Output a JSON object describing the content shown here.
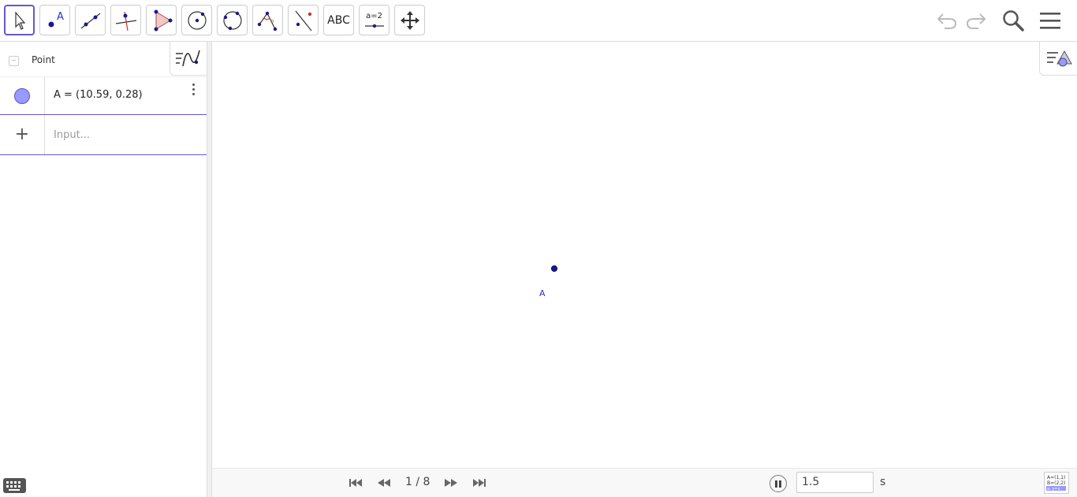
{
  "toolbar": {
    "tools": [
      {
        "id": "move",
        "icon": "pointer-icon"
      },
      {
        "id": "point",
        "icon": "point-icon",
        "label": "A"
      },
      {
        "id": "line",
        "icon": "line-icon"
      },
      {
        "id": "perpendicular",
        "icon": "perpendicular-icon"
      },
      {
        "id": "polygon",
        "icon": "polygon-icon"
      },
      {
        "id": "circle-center",
        "icon": "circle-center-icon"
      },
      {
        "id": "circle-three",
        "icon": "circle-three-points-icon"
      },
      {
        "id": "angle",
        "icon": "angle-icon"
      },
      {
        "id": "reflect",
        "icon": "reflect-icon"
      },
      {
        "id": "text",
        "icon": "text-icon",
        "label": "ABC"
      },
      {
        "id": "slider",
        "icon": "slider-icon",
        "label": "a=2"
      },
      {
        "id": "move-graphics",
        "icon": "move-graphics-icon"
      }
    ],
    "accent": "#6557d2"
  },
  "algebra": {
    "header_label": "Point",
    "collapse_symbol": "–",
    "object_row": {
      "definition": "A = (10.59, 0.28)",
      "color": "#9999ff"
    },
    "input_row": {
      "plus": "+",
      "placeholder": "Input..."
    }
  },
  "graphics": {
    "point_label": "A",
    "point_color": "#1a1a8c"
  },
  "animation": {
    "page_indicator": "1 / 8",
    "speed_value": "1.5",
    "speed_unit": "s"
  }
}
